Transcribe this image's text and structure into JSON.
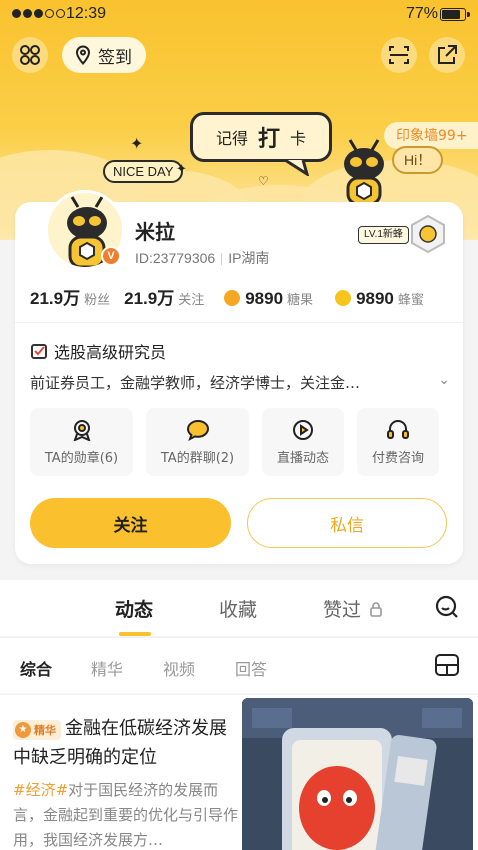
{
  "status_bar": {
    "time": "12:39",
    "battery": "77%"
  },
  "header": {
    "signin_label": "签到",
    "banner": {
      "bubble_left": "记得",
      "bubble_mid": "打",
      "bubble_right": "卡",
      "nice_day": "NICE DAY",
      "hi": "Hi！",
      "yinxiang": "印象墙99+"
    }
  },
  "profile": {
    "name": "米拉",
    "id_text": "ID:23779306",
    "ip_text": "IP湖南",
    "level_tag": "LV.1新蜂",
    "stats": [
      {
        "value": "21.9万",
        "label": "粉丝"
      },
      {
        "value": "21.9万",
        "label": "关注"
      },
      {
        "value": "9890",
        "label": "糖果",
        "coin_color": "#f5a623"
      },
      {
        "value": "9890",
        "label": "蜂蜜",
        "coin_color": "#f8c51c"
      }
    ],
    "cert": "选股高级研究员",
    "bio": "前证券员工，金融学教师，经济学博士，关注金…",
    "tiles": [
      {
        "label": "TA的勋章(6)",
        "icon": "medal-icon"
      },
      {
        "label": "TA的群聊(2)",
        "icon": "chat-bubble-icon"
      },
      {
        "label": "直播动态",
        "icon": "live-play-icon"
      },
      {
        "label": "付费咨询",
        "icon": "headset-icon"
      }
    ],
    "follow_label": "关注",
    "message_label": "私信"
  },
  "main_tabs": [
    {
      "label": "动态",
      "active": true
    },
    {
      "label": "收藏",
      "active": false
    },
    {
      "label": "赞过",
      "active": false,
      "locked": true
    }
  ],
  "sub_tabs": [
    {
      "label": "综合",
      "active": true
    },
    {
      "label": "精华",
      "active": false
    },
    {
      "label": "视频",
      "active": false
    },
    {
      "label": "回答",
      "active": false
    }
  ],
  "feed": {
    "post": {
      "badge": "精华",
      "title": "金融在低碳经济发展中缺乏明确的定位",
      "tag": "#经济#",
      "body": "对于国民经济的发展而言，金融起到重要的优化与引导作用，我国经济发展方…"
    }
  },
  "colors": {
    "accent": "#fbc02d",
    "accent_text": "#f0a81e",
    "badge_orange": "#ef7d2c"
  }
}
